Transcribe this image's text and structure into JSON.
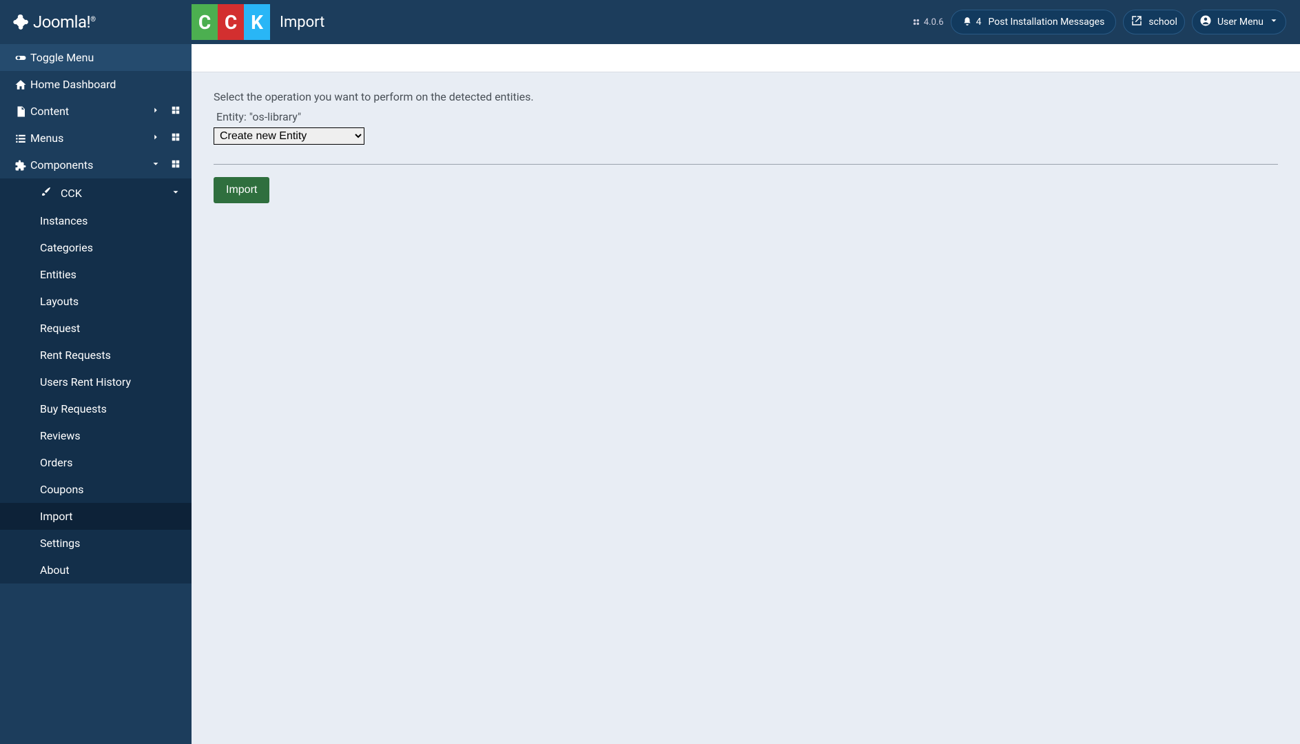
{
  "brand": "Joomla!",
  "header": {
    "logo_letters": [
      "C",
      "C",
      "K"
    ],
    "title": "Import",
    "version": "4.0.6",
    "notif_count": "4",
    "post_install": "Post Installation Messages",
    "site_name": "school",
    "user_menu": "User Menu"
  },
  "sidebar": {
    "toggle": "Toggle Menu",
    "items": [
      {
        "label": "Home Dashboard",
        "icon": "home"
      },
      {
        "label": "Content",
        "icon": "file",
        "expand": true,
        "grid": true
      },
      {
        "label": "Menus",
        "icon": "list",
        "expand": true,
        "grid": true
      },
      {
        "label": "Components",
        "icon": "puzzle",
        "expand": true,
        "expanded": true,
        "grid": true
      }
    ],
    "components_sub_header": "CCK",
    "components_sub": [
      {
        "label": "Instances"
      },
      {
        "label": "Categories"
      },
      {
        "label": "Entities"
      },
      {
        "label": "Layouts"
      },
      {
        "label": "Request"
      },
      {
        "label": "Rent Requests"
      },
      {
        "label": "Users Rent History"
      },
      {
        "label": "Buy Requests"
      },
      {
        "label": "Reviews"
      },
      {
        "label": "Orders"
      },
      {
        "label": "Coupons"
      },
      {
        "label": "Import",
        "active": true
      },
      {
        "label": "Settings"
      },
      {
        "label": "About"
      }
    ]
  },
  "main": {
    "description": "Select the operation you want to perform on the detected entities.",
    "entity_label": "Entity: \"os-library\"",
    "select_value": "Create new Entity",
    "import_button": "Import"
  }
}
